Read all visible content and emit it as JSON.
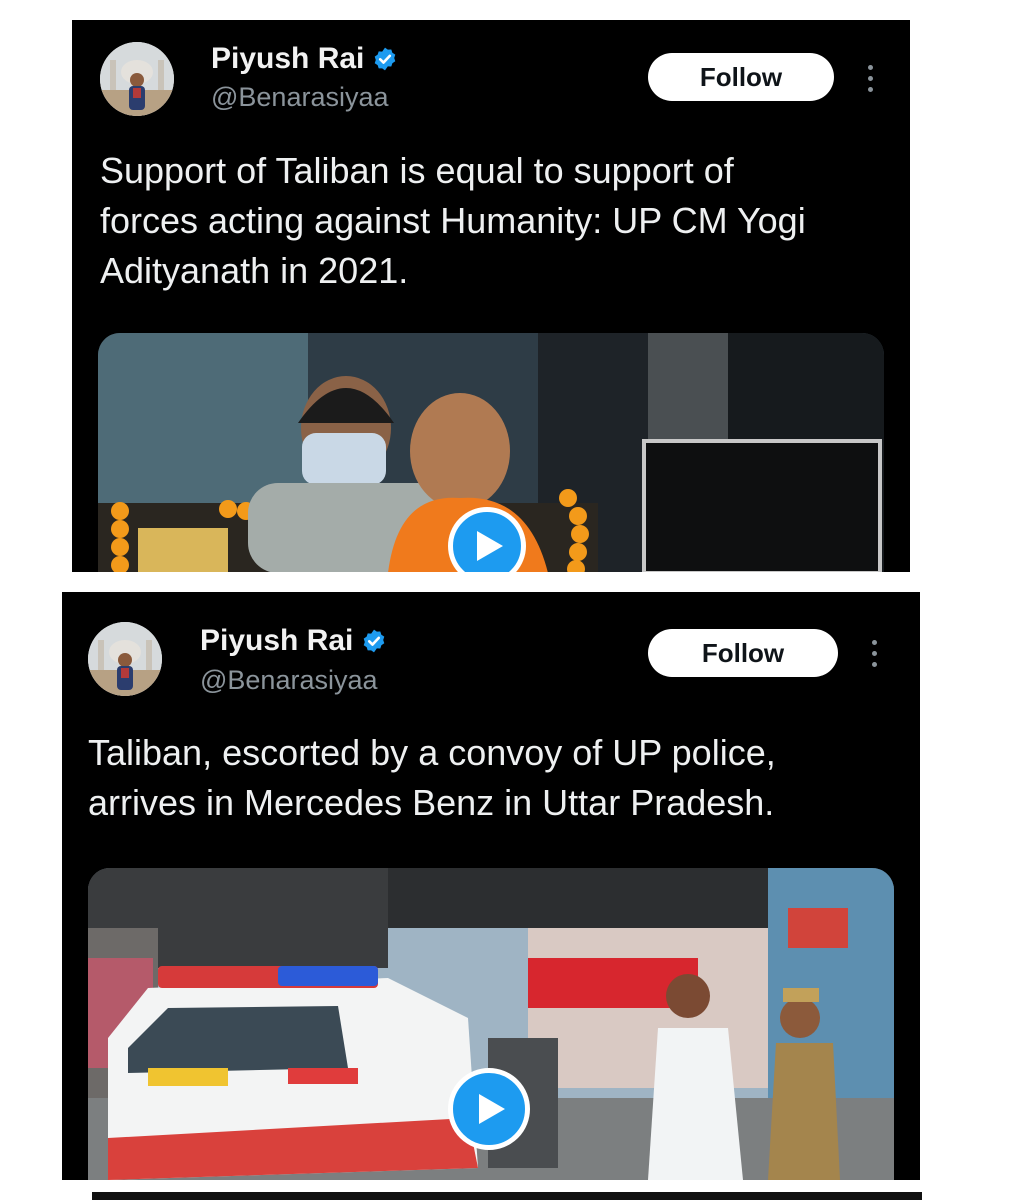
{
  "tweets": [
    {
      "author_name": "Piyush Rai",
      "author_handle": "@Benarasiyaa",
      "follow_label": "Follow",
      "text_lines": [
        "Support of Taliban is equal to support of",
        "forces acting against Humanity: UP CM Yogi",
        "Adityanath in 2021."
      ],
      "media_type": "video",
      "media_icon": "play-icon"
    },
    {
      "author_name": "Piyush Rai",
      "author_handle": "@Benarasiyaa",
      "follow_label": "Follow",
      "text_lines": [
        "Taliban, escorted by a convoy of UP police,",
        "arrives in Mercedes Benz in Uttar Pradesh."
      ],
      "media_type": "video",
      "media_icon": "play-icon"
    }
  ],
  "colors": {
    "background": "#000000",
    "verified_badge": "#1d9bf0",
    "play_button": "#1d9bf0",
    "follow_button": "#ffffff",
    "handle_text": "#8b949b"
  }
}
